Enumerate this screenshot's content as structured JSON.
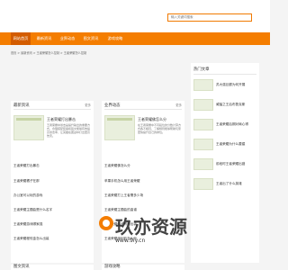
{
  "search": {
    "placeholder": "输入关键词搜索"
  },
  "nav": {
    "items": [
      "网站首页",
      "最新资讯",
      "业界动态",
      "图文资讯",
      "游戏攻略"
    ]
  },
  "breadcrumb": "首页 > 最新资讯 > 王者荣耀怎么控制 > 王者荣耀怎么控制",
  "latest": {
    "title": "最新资讯",
    "more": "更多",
    "feature_title": "王者荣耀打出暴击",
    "feature_desc": "王者荣耀中暴击是提升输出的重要方式，合理搭配装备和铭文能够有效提高暴击率，让英雄在团战中打出更高伤害。",
    "items": [
      "王者荣耀打出暴击",
      "王者荣耀橘子在那",
      "办公室可以玩的游戏",
      "王者荣耀主题曲是什么名字",
      "王者荣耀游戏哪家强",
      "王者荣耀程咬金怎么出装"
    ]
  },
  "industry": {
    "title": "业界动态",
    "more": "更多",
    "feature_title": "王者荣耀佛怎么分",
    "feature_desc": "在王者荣耀中不同段位的分数计算方式各不相同，了解规则能够帮助玩家更快提升自己的排位。",
    "items": [
      "王者荣耀佛怎么分",
      "苹果手机怎么用王者荣耀",
      "王者荣耀打上王者需多少场",
      "王者荣耀主题曲的曲谱",
      "王者荣耀伍子胥的出装",
      "王者荣耀伊利亚怎么玩"
    ]
  },
  "hot": {
    "title": "热门文章",
    "items": [
      "苏大强巨额为何开展",
      "威猛之王后布鲁克斯",
      "王者荣耀后期对局心得",
      "王者荣耀为什么要建",
      "前段时王者荣耀出错",
      "王者出了什么英雄"
    ]
  },
  "bottom": {
    "left_title": "图文资讯",
    "mid_title": "游戏攻略"
  },
  "watermark": {
    "text": "玖亦资源",
    "sub": "www.9iy.cn"
  }
}
